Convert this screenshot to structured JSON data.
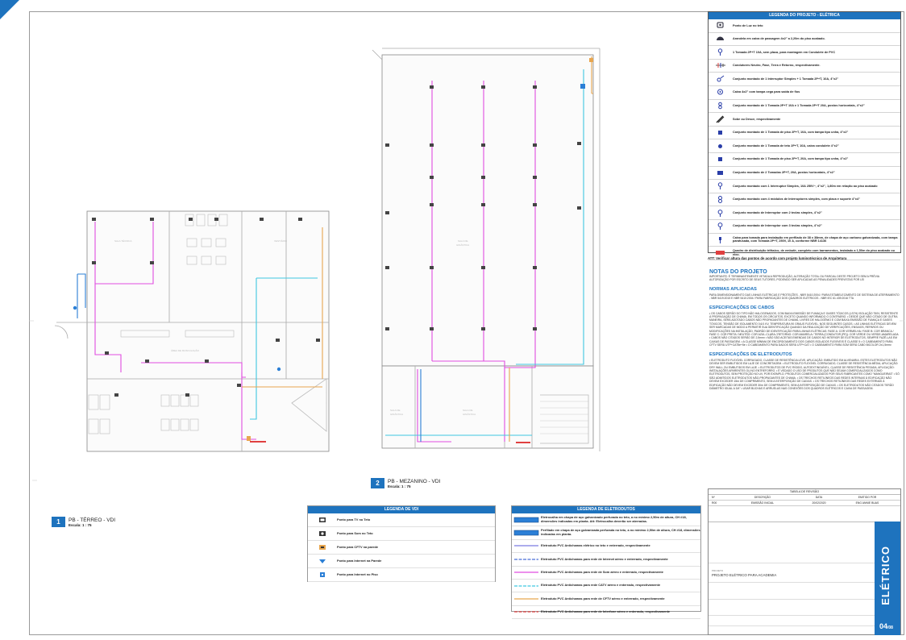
{
  "electric_legend": {
    "title": "LEGENDA DO PROJETO - ELÉTRICA",
    "items": [
      {
        "text": "Ponto de Luz no teto",
        "icon": "ceiling-light-icon"
      },
      {
        "text": "Arandela em caixa de passagem 4x2\" a 2,20m do piso acabado.",
        "icon": "wall-sconce-icon"
      },
      {
        "text": "1 Tomada 2P+T 10A, sem placa, para montagem em Condulete de PVC",
        "icon": "outlet-icon"
      },
      {
        "text": "Condutores Neutro, Fase, Terra e Retorno, respectivamente.",
        "icon": "conductors-icon"
      },
      {
        "text": "Conjunto montado de 1 Interruptor Simples + 1 Tomada 2P+T, 10A, 4\"x2\"",
        "icon": "switch-outlet-icon"
      },
      {
        "text": "Caixa 4x2\" com tampa cega para saída de fios",
        "icon": "blind-box-icon"
      },
      {
        "text": "Conjunto montado de 1 Tomada 2P+T 10A e 1 Tomada 2P+T 20A, postos horizontais, 4\"x2\"",
        "icon": "double-outlet-icon"
      },
      {
        "text": "Sobe ou Desce, respectivamente",
        "icon": "up-down-icon"
      },
      {
        "text": "Conjunto montado de 1 Tomada de piso 2P+T, 10A, com tampa tipo unha, 4\"x2\"",
        "icon": "floor-outlet-icon"
      },
      {
        "text": "Conjunto montado de 1 Tomada de teto 2P+T, 10A, caixa condulete 4\"x2\"",
        "icon": "ceiling-outlet-icon"
      },
      {
        "text": "Conjunto montado de 1 Tomada de piso 2P+T, 20A, com tampa tipo unha, 4\"x2\"",
        "icon": "floor-outlet-20a-icon"
      },
      {
        "text": "Conjunto montado de 2 Tomadas 2P+T, 20A, postos horizontais, 4\"x2\"",
        "icon": "two-outlets-icon"
      },
      {
        "text": "Conjunto montado com 1 Interruptor Simples, 10A 250V~, 4\"x2\", 1,80m em relação ao piso acabado",
        "icon": "switch-icon"
      },
      {
        "text": "Conjunto montado com 4 módulos de Interruptores simples, com placa e suporte 4\"x4\"",
        "icon": "four-switch-icon"
      },
      {
        "text": "Conjunto montado de Interruptor com 2 teclas simples, 4\"x2\"",
        "icon": "two-key-switch-icon"
      },
      {
        "text": "Conjunto montado de Interruptor com 3 teclas simples, 4\"x2\"",
        "icon": "three-key-switch-icon"
      },
      {
        "text": "Caixa para tomada para instalação em perfilado de 38 x 38mm, de chapa de aço carbono galvanizada, com tampa parafusada, com Tomada 2P+T, 250V, 10 A, conforme NBR 14136",
        "icon": "profile-box-icon"
      },
      {
        "text": "Quadro de distribuição trifásico, de embutir, completo com barramentos, instalado a 1,50m do piso acabado ou eixo.",
        "icon": "distribution-board-icon"
      }
    ]
  },
  "att_note": "ATT: Verificar altura das pontos de acordo com projeto luminotécnico de Arquitetura",
  "notes": {
    "title": "NOTAS DO PROJETO",
    "intro": "IMPORTANTE: É TERMINANTEMENTE VETADA A REPRODUÇÃO, ALTERAÇÃO TOTAL OU PARCIAL DESTE PROJETO SEM A PRÉVIA AUTORIZAÇÃO POR ESCRITO DE SEUS TUTORES, PODENDO SER APLICADAS AS PENALIDADES PREVISTAS POR LEI",
    "normas_title": "NORMAS APLICADAS",
    "normas": "PARA DIMENSIONAMENTO DAS LINHAS ELÉTRICAS E PROTEÇÕES - NBR 5410:2004 / PARA ESTABELECIMENTO DE SISTEMA DE ATERRAMENTO - NBR 5419:2015 E NBR 5410:2004 / PARA FABRICAÇÃO DOS QUADROS ELÉTRICOS - NBR IEC 61.439:2016 TTA",
    "cabos_title": "ESPECIFICAÇÕES DE CABOS",
    "cabos": "• OS CABOS SERÃO DO TIPO NÃO HALOGENADOS, COM BAIXA EMISSÃO DE FUMAÇA E GASES TÓXICOS (LS7H) ISOLAÇÃO 750V, RESISTENTE À PROPAGAÇÃO DE CHAMA, EM TODOS OS CIRCUITOS, EXCETO QUANDO INFORMADO O CONTRÁRIO. • DESDE QUE NÃO CITADO DE OUTRA MANEIRA, SERÁ ADOTADO CABOS NÃO PROPAGANTES DE CHAMA, LIVRES DE HALOGÊNIO E COM BAIXA EMISSÃO DE FUMAÇA E GASES TÓXICOS, TENSÃO DE ISOLAMENTO 0,6/1 KV, TEMPERATURA 90 GRAUS FLEXÍVEL, NOS SEGUINTES CASOS. • AS LINHAS ELÉTRICAS DEVEM SER MARCADAS DE MODO A PERMITIR SUA IDENTIFICAÇÃO QUANDO DA REALIZAÇÃO DE VERIFICAÇÕES, ENSAIOS, REPAROS OU MODIFICAÇÕES NA INSTALAÇÃO, PADRÃO DE IDENTIFICAÇÃO PARA LINHAS ELÉTRICAS: FASE A: COR VERMELHA / FASE B: COR BRANCA / FASE C: COR PRETA / NEUTRO: COR AZUL-CLARA / RETORNO: COR AMARELA / TERRA (CONDUTOR (PE)): COR VERDE OU VERDE-AMARELADA • CABOS NÃO CITADOS SERÃO DE 2,5mm² • NÃO SÃO ACEITAS EMENDAS DE CABOS NO INTERIOR DE ELETRODUTOS, SEMPRE FAZÊ-LAS EM CAIXAS DE PASSAGEM. • A CLASSE MÍNIMA DE ENCORDOAMENTO DOS CABOS ISOLADOS FLEXÍVEIS É CLASSE 5 • O CABEAMENTO PARA CFTV SERÁ UTP+CAT5e+5e • O CABEAMENTO PARA DADOS SERÁ UTP+CAT • O CABEAMENTO PARA SOM SERÁ CABO BICOLOR 2x1,5mm²",
    "eletro_title": "ESPECIFICAÇÕES DE ELETRODUTOS",
    "eletro": "• ELETRODUTO FLEXÍVEL CORRUGADO, CLASSE DE RESISTÊNCIA LEVE, APLICAÇÃO: EMBUTIDO EM ALVENARIA. ESTES ELETRODUTOS NÃO DEVEM SER EMBUTIDOS EM LAJE DE CONCRETAGEM. • ELETRODUTO FLEXÍVEL CORRUGADO, CLASSE DE RESISTÊNCIA MÉDIA, APLICAÇÃO: DRY WALL OU EMBUTIDOS EM LAJE. • ELETRODUTOS DE PVC RÍGIDO, AUTOEXTINGUÍVEL, CLASSE DE RESISTÊNCIA PESADA, APLICAÇÃO: INSTALAÇÕES APARENTES OU NO ENTREFORRO. • É VEDADO O USO DE PRODUTOS QUE NÃO SEJAM COMERCIALIZADOS COMO ELETRODUTOS, SEM PROTEÇÃO NO UV, POR EXEMPLO, PRODUTOS COMERCIALIZADOS POR SEUS FABRICANTES COMO \"MANGUEIRAS\" • SÓ SÃO ADMITIDOS ELETRODUTOS NÃO-PROPAGANTES DE CHAMA. • OS TRECHOS RETILÍNEOS DAS REDES INTERNAS À EDIFICAÇÃO NÃO DEVEM EXCEDER 15m DE COMPRIMENTO, SEM A INTERPOSIÇÃO DE CAIXAS. • OS TRECHOS RETILÍNEOS DAS REDES EXTERNAS À EDIFICAÇÃO NÃO DEVEM EXCEDER 30m DE COMPRIMENTO, SEM A INTERPOSIÇÃO DE CAIXAS. • OS ELETRODUTOS NÃO CITADOS TERÃO DIÂMETRO IGUAL A 3/4\" • USAR BUCHAS E ARRUELAS NAS CONEXÕES DOS QUADROS ELÉTRICOS E CAIXA DE PASSAGEM."
  },
  "plans": {
    "p1": {
      "num": "1",
      "name": "PB - TÉRREO - VDI",
      "scale": "Escala: 1 : 75"
    },
    "p2": {
      "num": "2",
      "name": "PB - MEZANINO - VDI",
      "scale": "Escala: 1 : 75"
    }
  },
  "vdi_legend": {
    "title": "LEGENDA DE VDI",
    "items": [
      {
        "text": "Ponto para TV no Teto",
        "icon": "tv-icon"
      },
      {
        "text": "Ponto para Som no Teto",
        "icon": "speaker-icon"
      },
      {
        "text": "Ponto para CFTV na parede",
        "icon": "camera-icon"
      },
      {
        "text": "Ponto para Internet na Parede",
        "icon": "wifi-icon"
      },
      {
        "text": "Ponto para Internet no Piso",
        "icon": "floor-data-icon"
      }
    ]
  },
  "eletro_legend": {
    "title": "LEGENDA DE ELETRODUTOS",
    "items": [
      {
        "text": "Eletrocalha em chapa de aço galvanizado perfurada no teto, a no mínimo 2,50m de altura, CH #18, dimensões indicadas em planta. Att: Eletrocalha deverão ser aterradas.",
        "color": "#2b7fd6",
        "kind": "tray"
      },
      {
        "text": "Perfilado em chapa de aço galvanizada perfurada no teto, a no mínimo 2,50m de altura, CH #18, dimensões indicadas em planta.",
        "color": "#2b7fd6",
        "kind": "tray"
      },
      {
        "text": "Eletroduto PVC Antichamas elétrico no teto e enterrado, respectivamente",
        "color": "#7a7ae0",
        "kind": "line"
      },
      {
        "text": "Eletroduto PVC Antichamas para rede de Internet aéreo e enterrado, respectivamente",
        "color": "#4b6fd6",
        "kind": "line"
      },
      {
        "text": "Eletroduto PVC Antichamas para rede de Som aéreo e enterrado, respectivamente",
        "color": "#e14de0",
        "kind": "line"
      },
      {
        "text": "Eletroduto PVC Antichamas para rede CATV aéreo e enterrado, respectivamente",
        "color": "#3fc7e0",
        "kind": "line"
      },
      {
        "text": "Eletroduto PVC Antichamas para rede de CFTV aéreo e enterrado, respectivamente",
        "color": "#e8a64f",
        "kind": "line"
      },
      {
        "text": "Eletroduto PVC Antichamas para rede de Interfone aéreo e enterrado, respectivamente",
        "color": "#e04040",
        "kind": "line"
      }
    ]
  },
  "title_block": {
    "rev_title": "TABELA DE REVISÃO",
    "rev_headers": [
      "Nº",
      "DESCRIÇÃO",
      "DATA",
      "EMITIDO POR"
    ],
    "rev_row": [
      "R00",
      "EMISSÃO INICIAL",
      "20/02/2020",
      "ENG ANNIE BUAS"
    ],
    "project_label": "PROJETO",
    "project_value": "PROJETO ELÉTRICO PARA ACADEMIA",
    "discipline": "ELÉTRICO",
    "sheet": "04",
    "sheet_total": "08"
  },
  "colors": {
    "accent": "#1e73be",
    "som": "#e14de0",
    "catv": "#3fc7e0",
    "cftv": "#e8a64f",
    "interfone": "#e04040"
  }
}
